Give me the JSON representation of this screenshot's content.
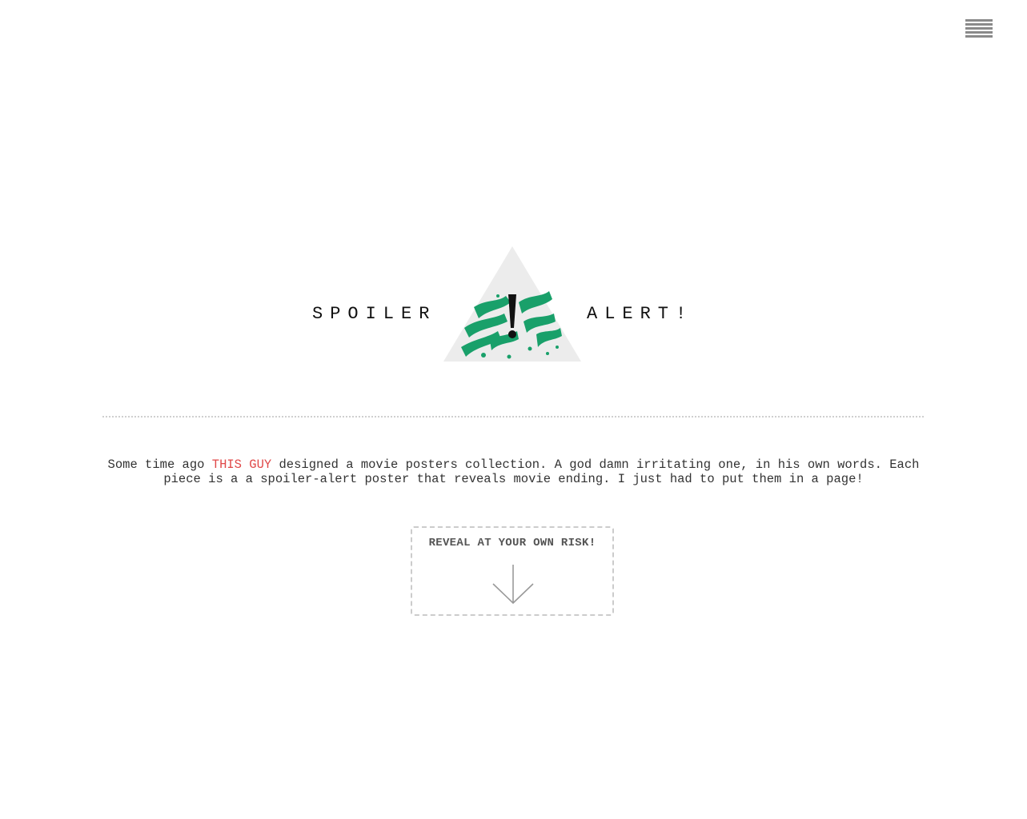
{
  "header": {
    "menu_icon": "hamburger-menu-icon"
  },
  "hero": {
    "left_word": "SPOILER",
    "right_word": "ALERT!",
    "logo": "warning-triangle-logo",
    "logo_colors": {
      "triangle": "#ececec",
      "brush": "#19a06a",
      "mark": "#111111"
    }
  },
  "intro": {
    "before_link": "Some time ago ",
    "link_text": "THIS GUY",
    "after_link": " designed a movie posters collection. A god damn irritating one, in his own words. Each piece is a a spoiler-alert poster that reveals movie ending. I just had to put them in a page!",
    "link_color": "#e04848"
  },
  "reveal": {
    "label": "REVEAL AT YOUR OWN RISK!",
    "icon": "arrow-down-icon"
  }
}
